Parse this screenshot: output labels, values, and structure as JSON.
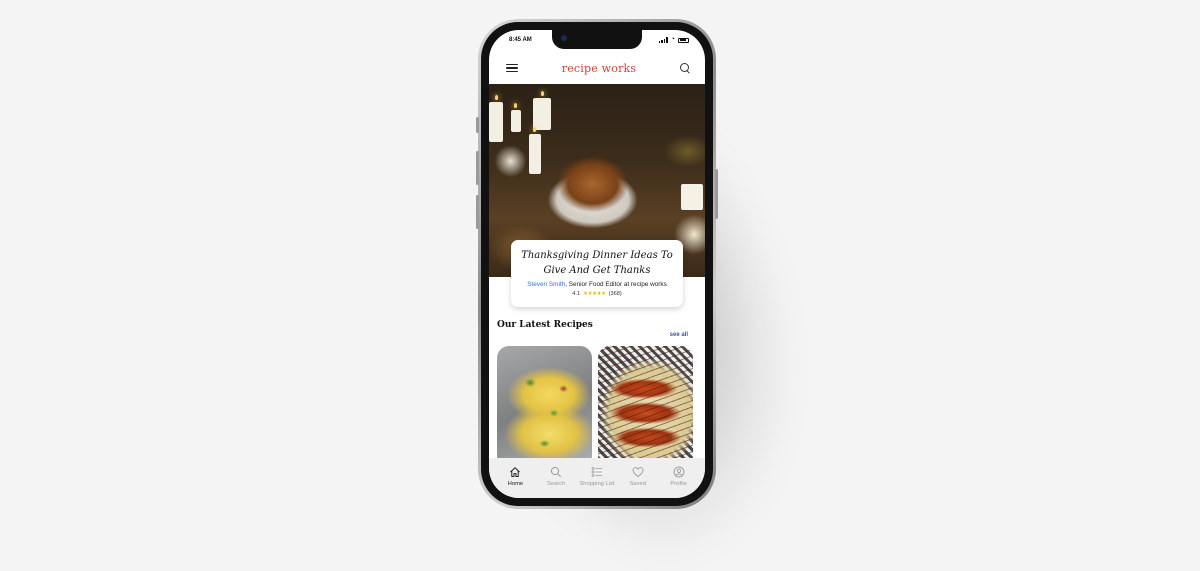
{
  "status_bar": {
    "time": "8:45 AM"
  },
  "app_bar": {
    "brand": "recipe works",
    "menu_icon": "hamburger-icon",
    "search_icon": "search-icon"
  },
  "featured": {
    "title": "Thanksgiving Dinner Ideas To Give And Get Thanks",
    "author_name": "Steven Smith",
    "author_role": ", Senior Food Editor at recipe works",
    "rating": "4.1",
    "stars": "★★★★★",
    "reviews": "(368)"
  },
  "latest": {
    "heading": "Our Latest Recipes",
    "see_all": "see all"
  },
  "tabs": [
    {
      "label": "Home",
      "icon": "home-icon",
      "active": true
    },
    {
      "label": "Search",
      "icon": "search-icon",
      "active": false
    },
    {
      "label": "Shopping List",
      "icon": "list-icon",
      "active": false
    },
    {
      "label": "Saved",
      "icon": "heart-icon",
      "active": false
    },
    {
      "label": "Profile",
      "icon": "profile-icon",
      "active": false
    }
  ],
  "colors": {
    "brand": "#d8402f",
    "link": "#3f6fd0",
    "see_all": "#3f51b5",
    "star": "#f2b51c"
  }
}
